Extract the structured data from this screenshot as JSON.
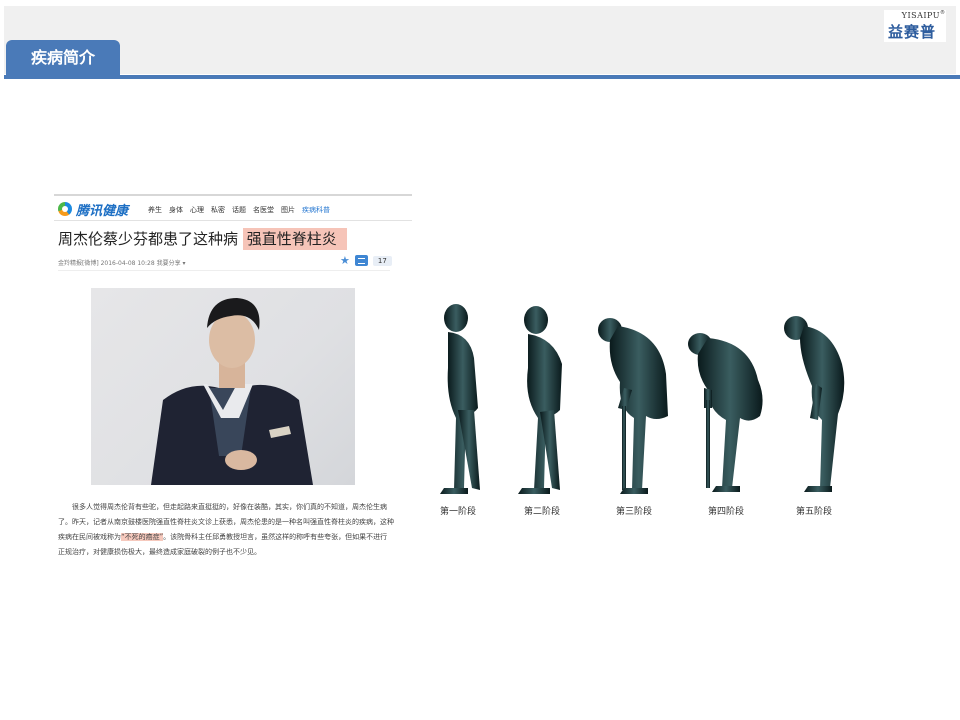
{
  "header": {
    "section_title": "疾病简介",
    "logo_en": "YISAIPU",
    "logo_cn": "益赛普"
  },
  "article": {
    "site_name": "腾讯健康",
    "nav": [
      "养生",
      "身体",
      "心理",
      "私密",
      "话题",
      "名医堂",
      "图片",
      "疾病科普"
    ],
    "headline_plain": "周杰伦蔡少芬都患了这种病 ",
    "headline_highlight": "强直性脊柱炎",
    "meta": "金羚精报[微博]  2016-04-08  10:28      我要分享 ▾",
    "comment_count": "17",
    "body_part1": "很多人觉得周杰伦背有些驼，但走起路来直挺挺的，好像在装酷，其实，你们真的不知道，周杰伦生病了。昨天，记者从南京鼓楼医院强直性脊柱炎文诊上获悉，周杰伦患的是一种名叫强直性脊柱炎的疾病，这种疾病在民间被戏称为",
    "body_highlight": "“不死的癌症”",
    "body_part2": "。该院骨科主任邱勇教授坦言，虽然这样的称呼有些夸张，但如果不进行正规治疗，对健康损伤极大，最终造成家庭破裂的例子也不少见。"
  },
  "stages": [
    "第一阶段",
    "第二阶段",
    "第三阶段",
    "第四阶段",
    "第五阶段"
  ]
}
